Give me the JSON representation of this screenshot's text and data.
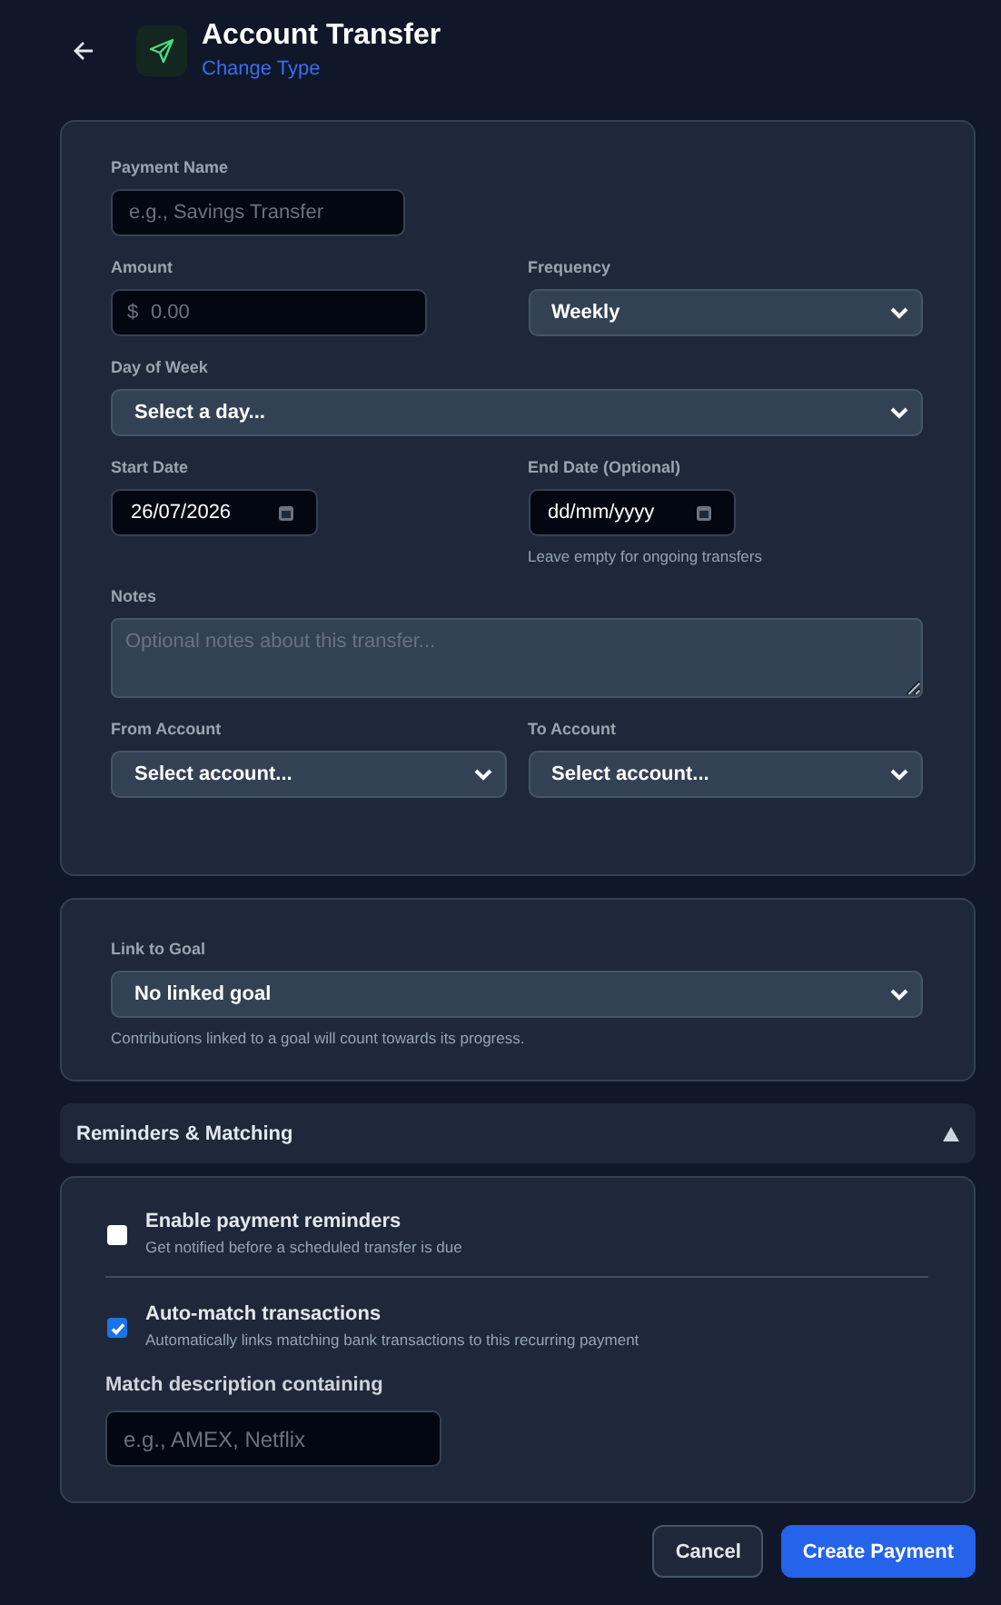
{
  "header": {
    "title": "Account Transfer",
    "change_type": "Change Type"
  },
  "details": {
    "payment_name": {
      "label": "Payment Name",
      "placeholder": "e.g., Savings Transfer"
    },
    "amount": {
      "label": "Amount",
      "currency": "$",
      "placeholder": "0.00"
    },
    "frequency": {
      "label": "Frequency",
      "value": "Weekly"
    },
    "day_of_week": {
      "label": "Day of Week",
      "value": "Select a day..."
    },
    "start_date": {
      "label": "Start Date",
      "value": "26/07/2026"
    },
    "end_date": {
      "label": "End Date (Optional)",
      "value": "dd/mm/yyyy",
      "hint": "Leave empty for ongoing transfers"
    },
    "notes": {
      "label": "Notes",
      "placeholder": "Optional notes about this transfer..."
    },
    "from_account": {
      "label": "From Account",
      "value": "Select account..."
    },
    "to_account": {
      "label": "To Account",
      "value": "Select account..."
    }
  },
  "goal": {
    "label": "Link to Goal",
    "value": "No linked goal",
    "hint": "Contributions linked to a goal will count towards its progress."
  },
  "reminders": {
    "title": "Reminders & Matching",
    "expanded": true,
    "options": [
      {
        "label": "Enable payment reminders",
        "description": "Get notified before a scheduled transfer is due",
        "checked": false
      },
      {
        "label": "Auto-match transactions",
        "description": "Automatically links matching bank transactions to this recurring payment",
        "checked": true
      }
    ],
    "match": {
      "label": "Match description containing",
      "placeholder": "e.g., AMEX, Netflix"
    }
  },
  "buttons": {
    "cancel": "Cancel",
    "create": "Create Payment"
  }
}
